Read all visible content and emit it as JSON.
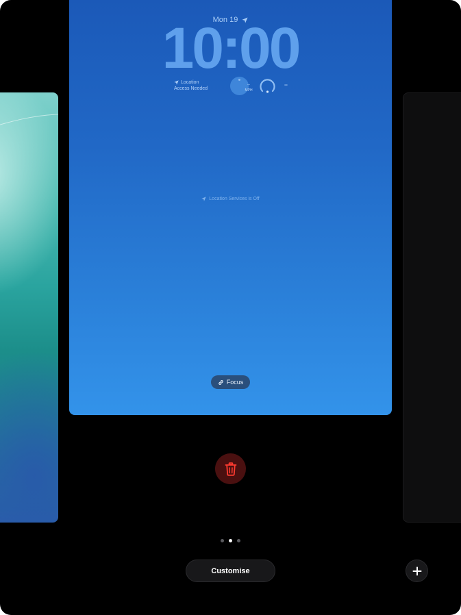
{
  "lock_screen": {
    "date": "Mon 19",
    "time": "10:00",
    "widgets": {
      "location_line1": "Location",
      "location_line2": "Access Needed",
      "speed_value": "--",
      "speed_unit": "MPH",
      "gauge_value": "--"
    },
    "location_status": "Location Services is Off",
    "focus_label": "Focus"
  },
  "controls": {
    "customise_label": "Customise",
    "page_count": 3,
    "active_page": 2
  },
  "icons": {
    "navigation": "location-arrow-icon",
    "link": "link-icon",
    "trash": "trash-icon",
    "add": "plus-icon"
  },
  "colors": {
    "trash_red": "#ff3b30",
    "delete_bg": "#4a1010",
    "time_blue": "#5fa0ec"
  }
}
